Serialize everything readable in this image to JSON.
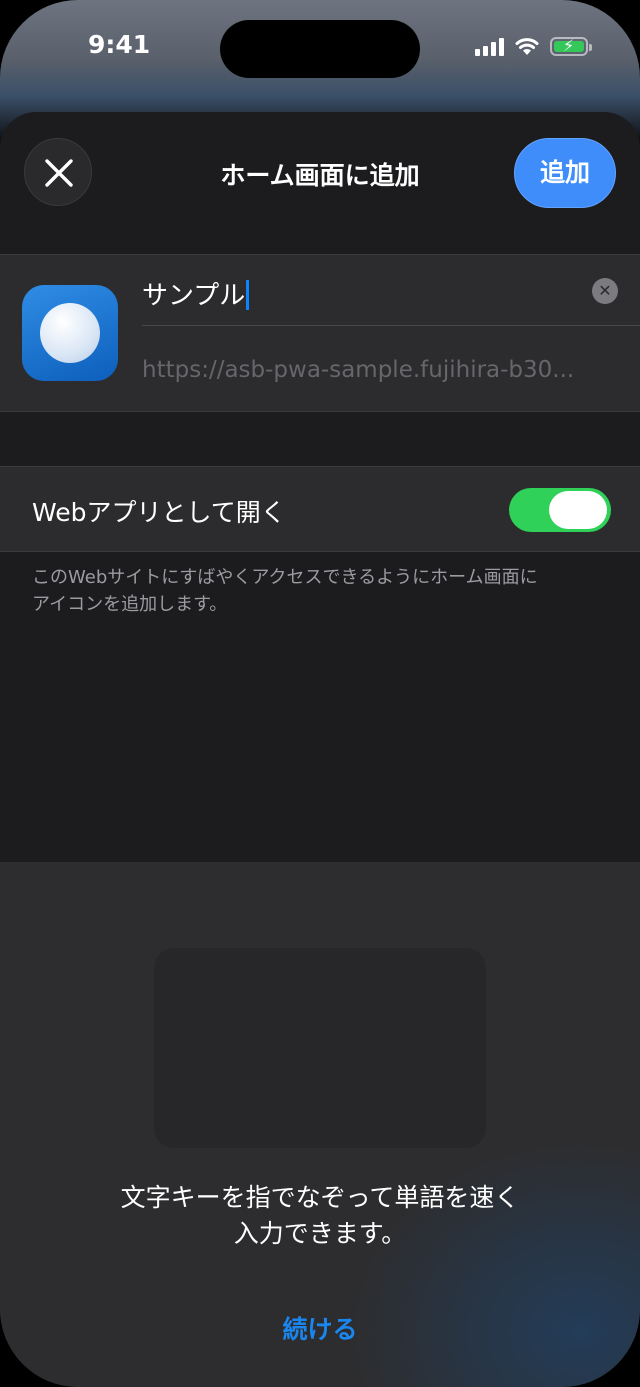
{
  "status_bar": {
    "time": "9:41",
    "icons": [
      "signal-icon",
      "wifi-icon",
      "battery-charging-icon"
    ],
    "battery_color": "#34c759"
  },
  "sheet": {
    "title": "ホーム画面に追加",
    "add_label": "追加",
    "close_icon": "close-icon",
    "name_value": "サンプル",
    "clear_icon": "clear-text-icon",
    "url": "https://asb-pwa-sample.fujihira-b30...",
    "web_app_label": "Webアプリとして開く",
    "web_app_toggle_on": true,
    "footnote_line1": "このWebサイトにすばやくアクセスできるようにホーム画面に",
    "footnote_line2": "アイコンを追加します。"
  },
  "keyboard_tutorial": {
    "line1": "文字キーを指でなぞって単語を速く",
    "line2": "入力できます。",
    "continue_label": "続ける"
  },
  "colors": {
    "accent": "#3e8dfb",
    "toggle_on": "#30d158",
    "link": "#1a86f0"
  }
}
